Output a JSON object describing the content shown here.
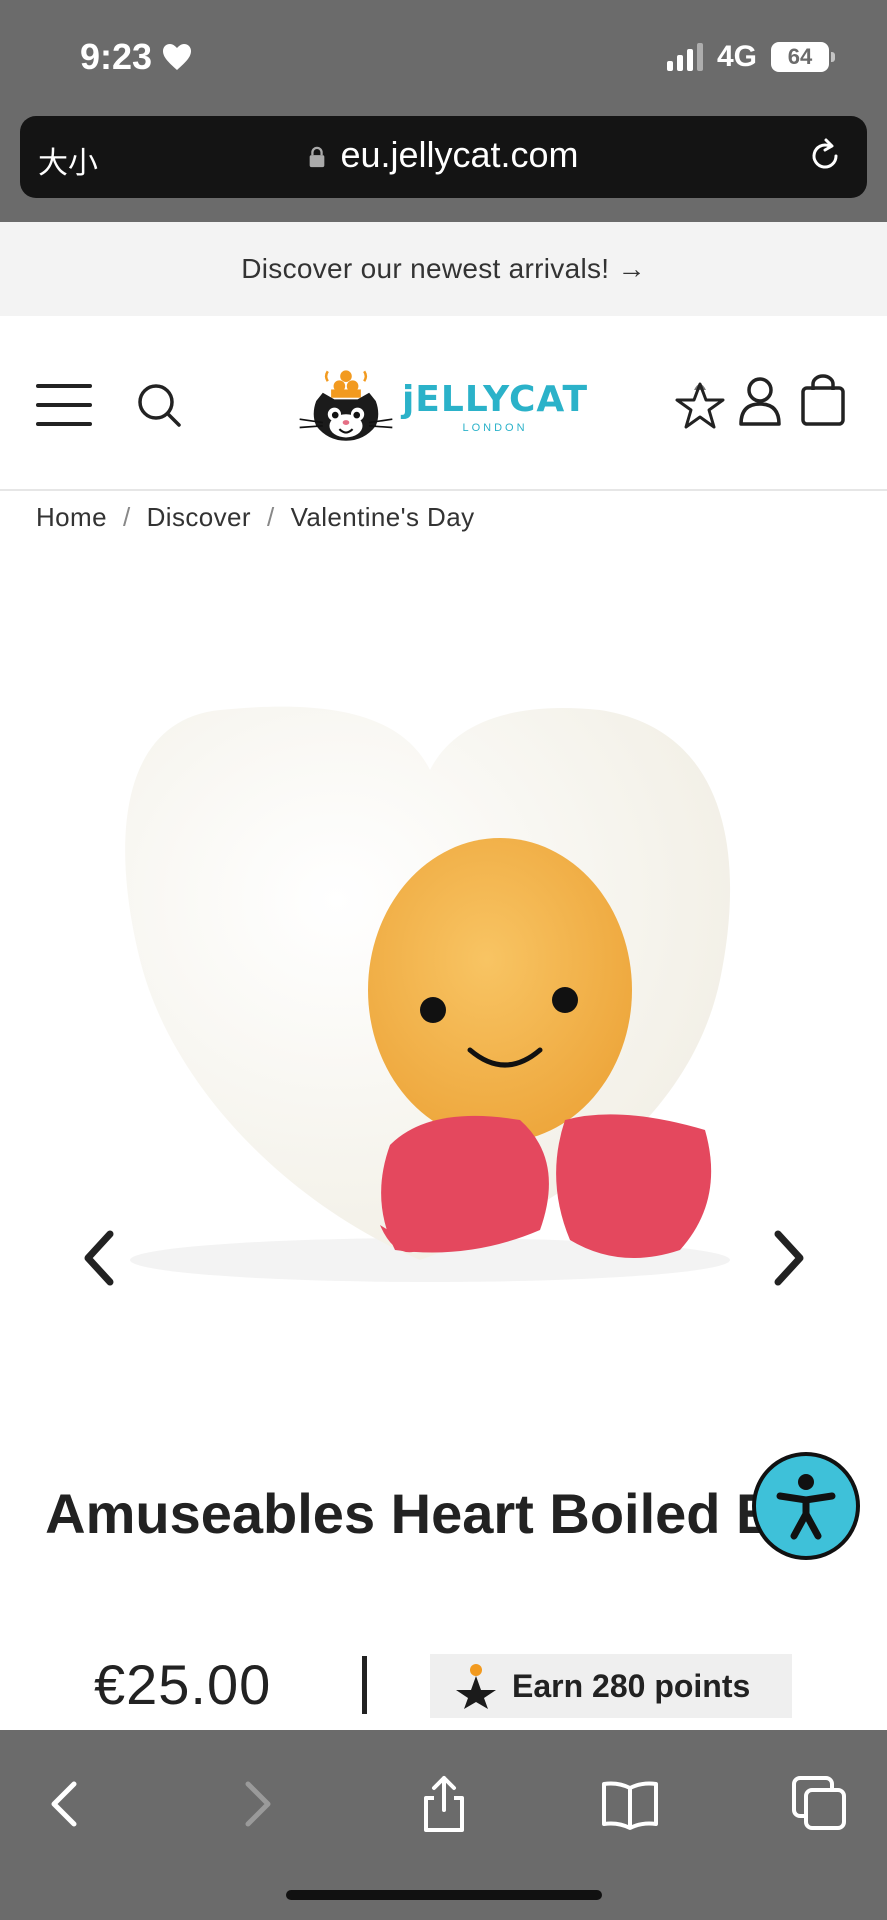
{
  "status_bar": {
    "time": "9:23",
    "network": "4G",
    "battery": "64"
  },
  "browser": {
    "text_size_label": "大小",
    "url": "eu.jellycat.com"
  },
  "promo": {
    "text": "Discover our newest arrivals! →"
  },
  "header": {
    "logo_word": "jELLYCAT",
    "logo_sub": "LONDON"
  },
  "breadcrumb": {
    "items": [
      "Home",
      "Discover",
      "Valentine's Day"
    ],
    "separator": "/"
  },
  "product": {
    "title": "Amuseables Heart Boiled Egg",
    "price": "€25.00",
    "points_label": "Earn 280 points"
  },
  "colors": {
    "chrome": "#6b6b6b",
    "brand_teal": "#2bb2c9",
    "accessibility": "#3ec1d9"
  }
}
